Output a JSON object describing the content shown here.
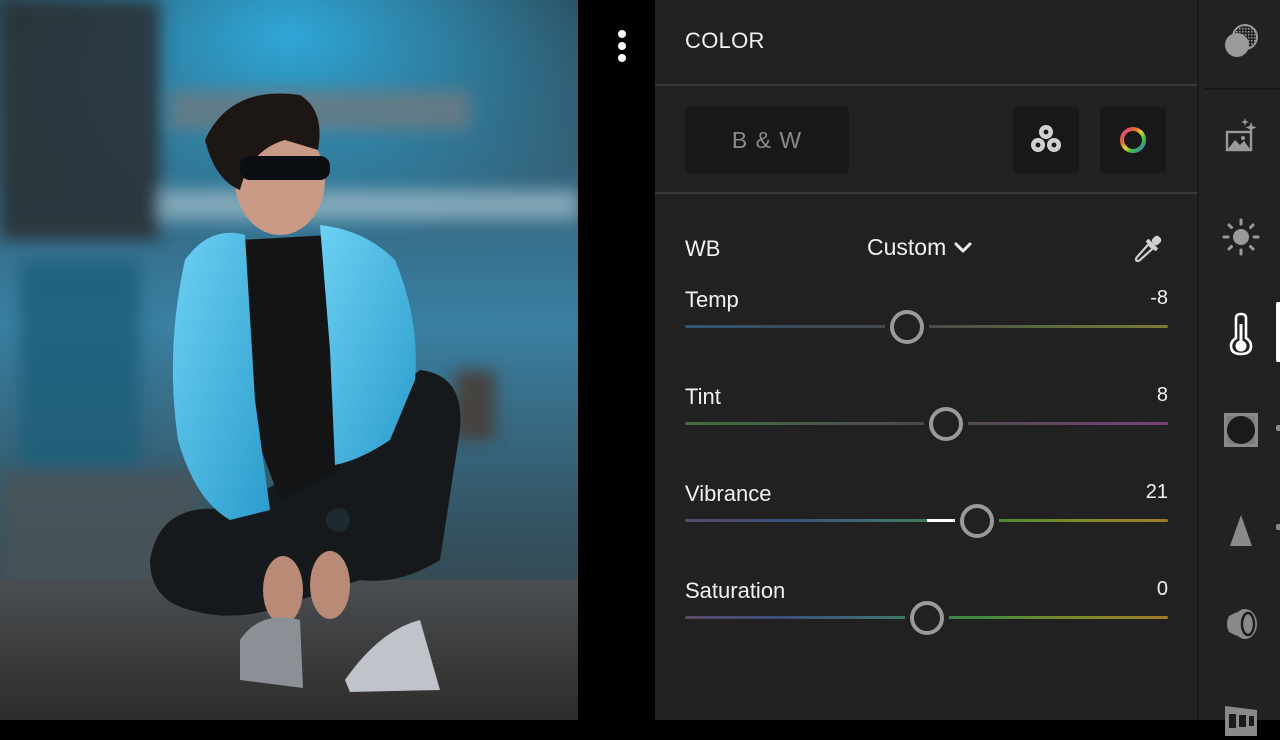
{
  "photo": {
    "description": "Young man in sunglasses and light blue denim jacket crouching, tying shoelaces on a dirt road in front of a blurred blue building"
  },
  "menu": {
    "icon": "more-vertical-icon"
  },
  "panel": {
    "title": "COLOR",
    "bw_button": "B & W",
    "mix_button_icon": "color-mix-circles-icon",
    "grading_button_icon": "color-grading-wheel-icon",
    "wb": {
      "label": "WB",
      "selected": "Custom",
      "eyedropper_icon": "eyedropper-icon"
    },
    "sliders": [
      {
        "id": "temp",
        "label": "Temp",
        "value": -8,
        "display": "-8",
        "min": -100,
        "max": 100,
        "gradient": [
          "#2e5877",
          "#3d4a55",
          "#4a4a4a",
          "#5b6a3f",
          "#7a7b36"
        ]
      },
      {
        "id": "tint",
        "label": "Tint",
        "value": 8,
        "display": "8",
        "min": -100,
        "max": 100,
        "gradient": [
          "#3f6e3f",
          "#4a5a4a",
          "#4a4a4a",
          "#5e4a5e",
          "#7a3f7a"
        ]
      },
      {
        "id": "vibrance",
        "label": "Vibrance",
        "value": 21,
        "display": "21",
        "min": -100,
        "max": 100,
        "gradient": [
          "#5a4a6a",
          "#3a4e7a",
          "#3f6e72",
          "#3f8a3f",
          "#7a8a2a",
          "#a07a2a"
        ]
      },
      {
        "id": "saturation",
        "label": "Saturation",
        "value": 0,
        "display": "0",
        "min": -100,
        "max": 100,
        "gradient": [
          "#5a4a6a",
          "#3a4e7a",
          "#3f6e72",
          "#3f8a3f",
          "#7a8a2a",
          "#a07a2a"
        ]
      }
    ]
  },
  "toolbar": {
    "items": [
      {
        "name": "masking",
        "icon": "masking-icon"
      },
      {
        "name": "auto",
        "icon": "auto-enhance-icon"
      },
      {
        "name": "light",
        "icon": "sun-icon"
      },
      {
        "name": "color",
        "icon": "thermometer-icon",
        "active": true
      },
      {
        "name": "effects",
        "icon": "vignette-icon"
      },
      {
        "name": "detail",
        "icon": "triangle-icon"
      },
      {
        "name": "optics",
        "icon": "lens-icon"
      },
      {
        "name": "geometry",
        "icon": "geometry-icon"
      }
    ]
  }
}
